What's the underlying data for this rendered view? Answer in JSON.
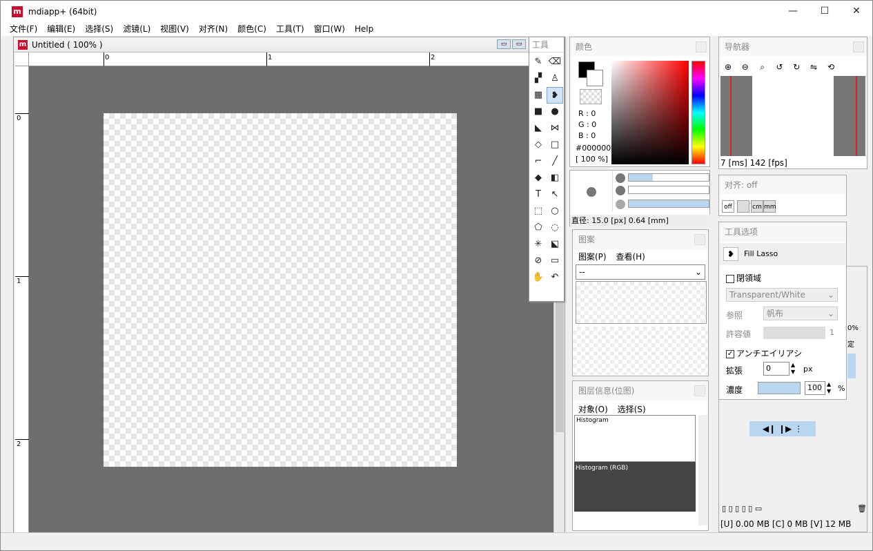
{
  "app": {
    "title": "mdiapp+ (64bit)",
    "logo": "m"
  },
  "window_controls": {
    "minimize": "—",
    "maximize": "☐",
    "close": "✕"
  },
  "menu": [
    "文件(F)",
    "编辑(E)",
    "选择(S)",
    "滤镜(L)",
    "视图(V)",
    "对齐(N)",
    "颜色(C)",
    "工具(T)",
    "窗口(W)",
    "Help"
  ],
  "document": {
    "title": "Untitled ( 100% )",
    "ruler_top": [
      "0",
      "1",
      "2"
    ],
    "ruler_left": [
      "0",
      "1",
      "2"
    ]
  },
  "tools": {
    "title": "工具",
    "items": [
      "✎",
      "⌫",
      "▞",
      "♙",
      "▦",
      "❥",
      "■",
      "●",
      "◣",
      "⋈",
      "◇",
      "□",
      "⌐",
      "╱",
      "◆",
      "◧",
      "T",
      "↖",
      "⬚",
      "○",
      "⬠",
      "◌",
      "✳",
      "⬕",
      "⊘",
      "▭",
      "✋",
      "↶"
    ],
    "active_index": 5
  },
  "color_panel": {
    "title": "颜色",
    "r": "R : 0",
    "g": "G : 0",
    "b": "B : 0",
    "hex": "#000000",
    "opacity": "[ 100 %]",
    "brush_size": "直径: 15.0 [px]  0.64 [mm]"
  },
  "navigator": {
    "title": "导航器",
    "fps": "7 [ms] 142 [fps]"
  },
  "snap": {
    "title": "对齐: off",
    "off": "off",
    "cm": "cm",
    "mm": "mm"
  },
  "tool_options": {
    "title": "工具选项",
    "tool_name": "Fill Lasso",
    "close_region": "閉領域",
    "mode_value": "Transparent/White",
    "ref_label": "参照",
    "ref_value": "帆布",
    "tolerance_label": "許容値",
    "tolerance_value": "1",
    "antialias": "アンチエイリアシ",
    "expand_label": "拡張",
    "expand_value": "0",
    "expand_unit": "px",
    "density_label": "濃度",
    "density_value": "100",
    "density_unit": "%"
  },
  "pattern": {
    "title": "图案",
    "menu1": "图案(P)",
    "menu2": "查看(H)",
    "select": "--"
  },
  "layer_info": {
    "title": "图层信息(位图)",
    "menu1": "对象(O)",
    "menu2": "选择(S)",
    "hist1": "Histogram",
    "hist2": "Histogram (RGB)"
  },
  "layer_panel": {
    "memory": "[U] 0.00 MB [C] 0 MB [V] 12 MB",
    "partial1": "0%",
    "partial2": "定"
  },
  "colors": {
    "accent": "#c8102e",
    "selection": "#b9d7f0"
  }
}
